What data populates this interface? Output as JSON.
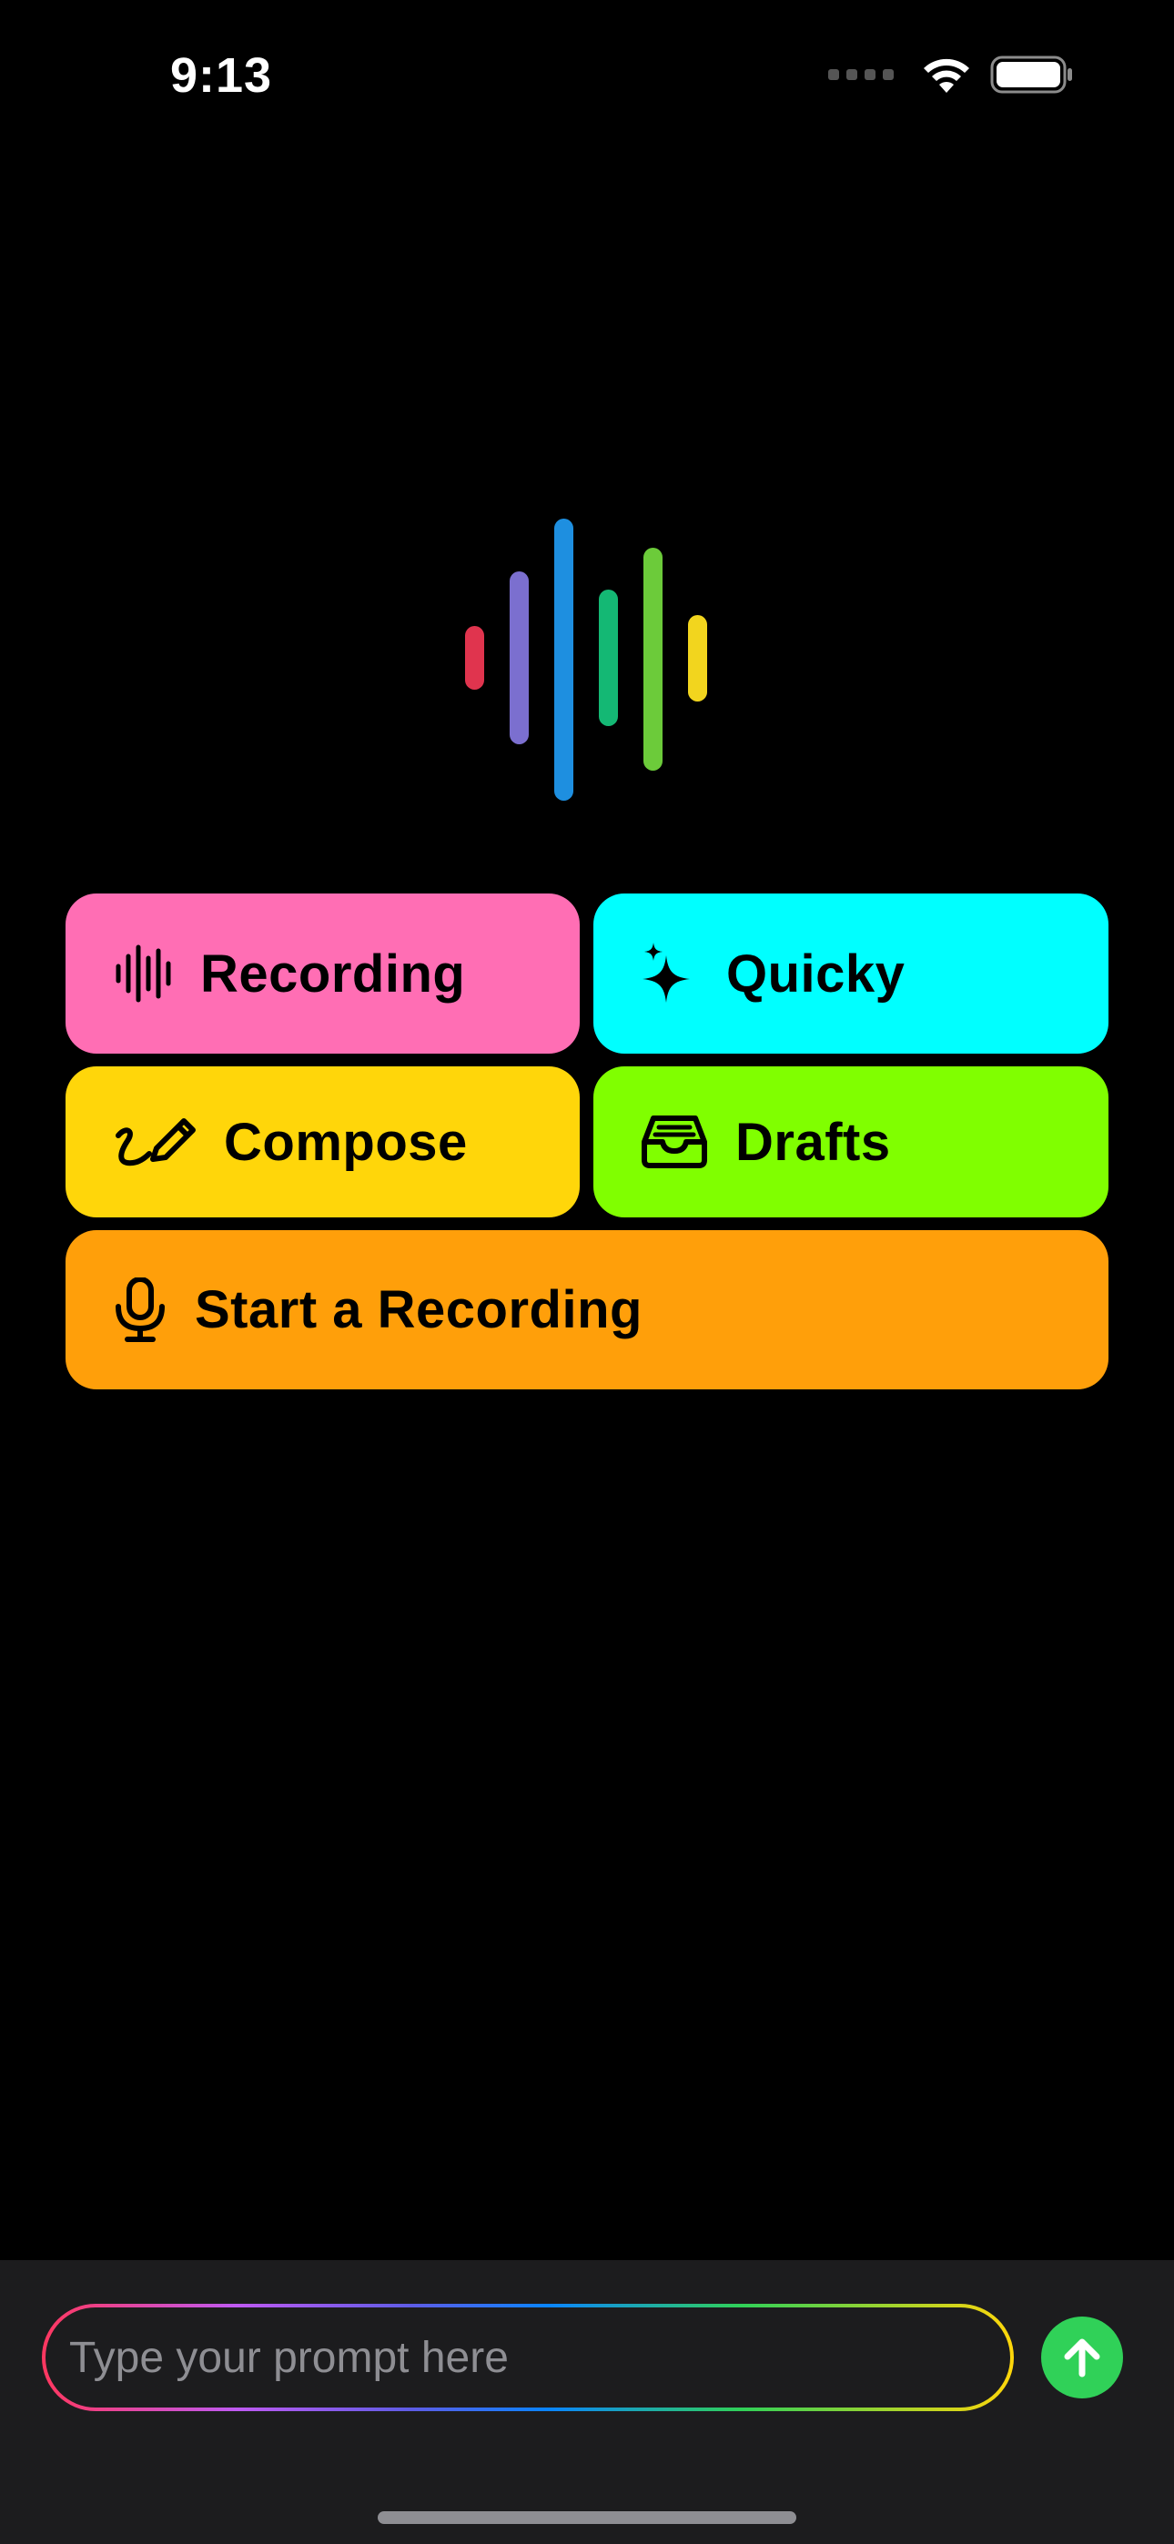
{
  "status_bar": {
    "time": "9:13",
    "icons": [
      "cellular-signal-icon",
      "wifi-icon",
      "battery-icon"
    ]
  },
  "logo": {
    "icon": "waveform-logo-icon",
    "bar_colors": [
      "#E0344E",
      "#7B6FCF",
      "#1E8FE0",
      "#14B874",
      "#6CCB3A",
      "#F2D51E"
    ]
  },
  "tiles": {
    "recording": {
      "label": "Recording",
      "icon": "waveform-icon",
      "color": "#FF6EB4"
    },
    "quicky": {
      "label": "Quicky",
      "icon": "sparkles-icon",
      "color": "#00FFFF"
    },
    "compose": {
      "label": "Compose",
      "icon": "pencil-scribble-icon",
      "color": "#FFD60A"
    },
    "drafts": {
      "label": "Drafts",
      "icon": "tray-icon",
      "color": "#80FF00"
    },
    "start_recording": {
      "label": "Start a Recording",
      "icon": "microphone-icon",
      "color": "#FF9F0A"
    }
  },
  "prompt": {
    "placeholder": "Type your prompt here",
    "value": ""
  },
  "send": {
    "icon": "arrow-up-icon",
    "color": "#30D158"
  }
}
